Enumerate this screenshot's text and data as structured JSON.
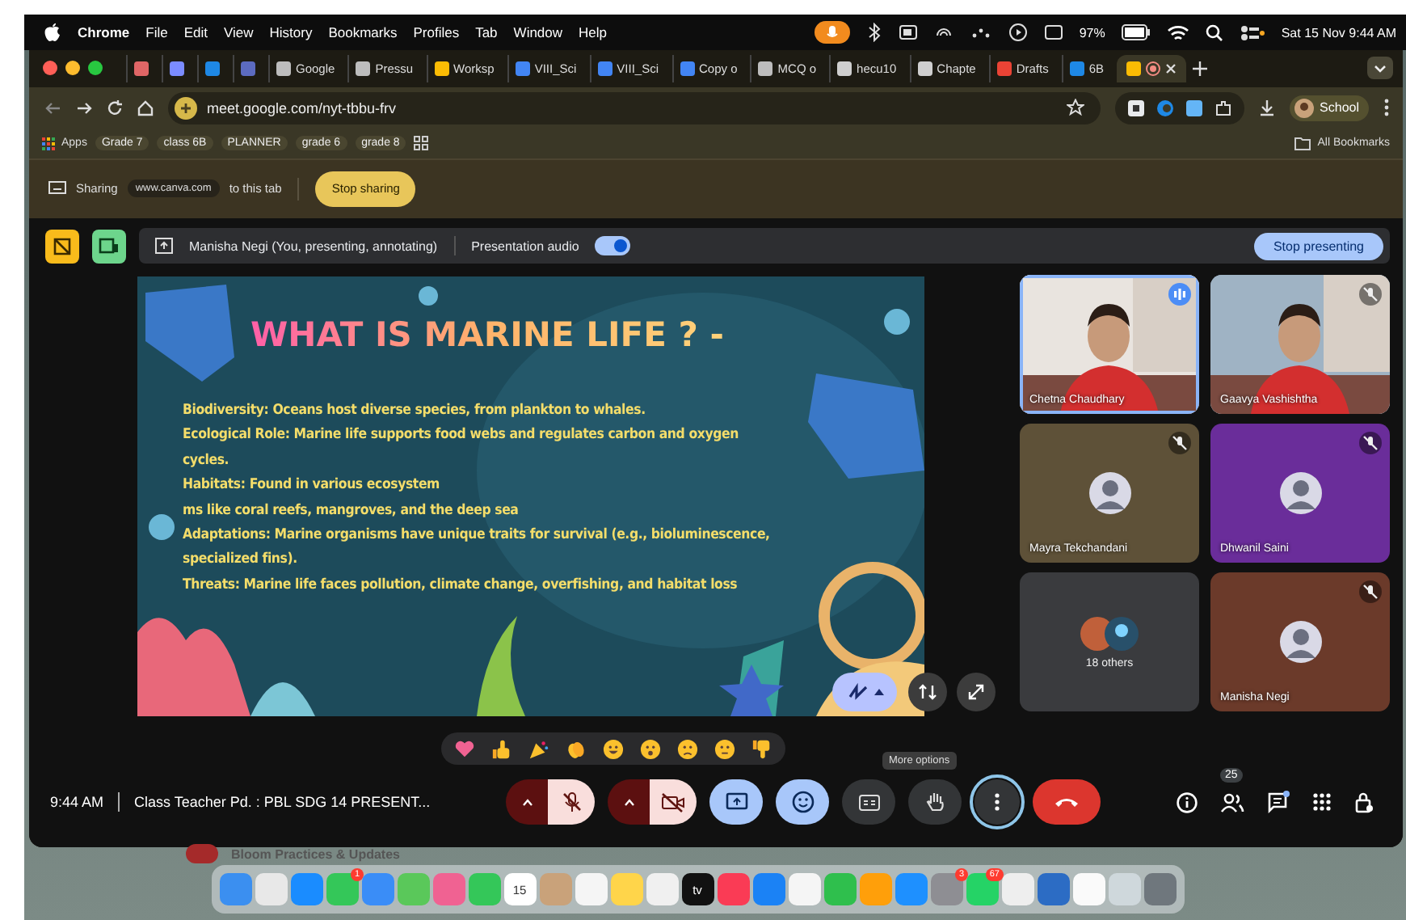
{
  "menu_bar": {
    "app": "Chrome",
    "items": [
      "File",
      "Edit",
      "View",
      "History",
      "Bookmarks",
      "Profiles",
      "Tab",
      "Window",
      "Help"
    ],
    "battery": "97%",
    "clock": "Sat 15 Nov 9:44 AM"
  },
  "tabs": [
    {
      "color": "#e06666",
      "selected": false
    },
    {
      "color": "#7b8cff",
      "selected": false
    },
    {
      "color": "#1e88e5",
      "selected": false
    },
    {
      "color": "#5c6bc0",
      "selected": false
    },
    {
      "title": "Google",
      "color": "#bdbdbd",
      "selected": false
    },
    {
      "title": "Pressu",
      "color": "#bdbdbd",
      "selected": false
    },
    {
      "title": "Worksp",
      "color": "#fbbc04",
      "selected": false
    },
    {
      "title": "VIII_Sci",
      "color": "#4285f4",
      "selected": false
    },
    {
      "title": "VIII_Sci",
      "color": "#4285f4",
      "selected": false
    },
    {
      "title": "Copy o",
      "color": "#4285f4",
      "selected": false
    },
    {
      "title": "MCQ o",
      "color": "#bdbdbd",
      "selected": false
    },
    {
      "title": "hecu10",
      "color": "#cfcfcf",
      "selected": false
    },
    {
      "title": "Chapte",
      "color": "#cfcfcf",
      "selected": false
    },
    {
      "title": "Drafts",
      "color": "#ea4335",
      "selected": false
    },
    {
      "title": "6B",
      "color": "#1e88e5",
      "selected": false
    },
    {
      "color": "#fbbc04",
      "selected": true
    }
  ],
  "address_bar": {
    "url": "meet.google.com/nyt-tbbu-frv",
    "profile": "School"
  },
  "bookmarks": {
    "items": [
      "Apps",
      "Grade 7",
      "class 6B",
      "PLANNER",
      "grade 6",
      "grade 8"
    ],
    "all": "All Bookmarks"
  },
  "sharing_bar": {
    "label": "Sharing",
    "site": "www.canva.com",
    "suffix": "to this tab",
    "button": "Stop sharing"
  },
  "presenter_bar": {
    "presenter": "Manisha Negi (You, presenting, annotating)",
    "audio_label": "Presentation audio",
    "audio_on": true,
    "button": "Stop presenting"
  },
  "slide": {
    "title": "WHAT IS MARINE LIFE ? -",
    "lines": [
      "Biodiversity: Oceans host diverse species, from plankton to whales.",
      "Ecological Role: Marine life supports food webs and regulates carbon and oxygen cycles.",
      "Habitats: Found in various ecosystem",
      "ms like coral reefs, mangroves, and the deep sea",
      "Adaptations: Marine organisms have unique traits for survival (e.g., bioluminescence, specialized fins).",
      "Threats: Marine life faces pollution, climate change, overfishing, and habitat loss"
    ]
  },
  "participants": [
    {
      "name": "Chetna Chaudhary",
      "kind": "video",
      "muted": false,
      "speaking": true,
      "color": "#e9e4df"
    },
    {
      "name": "Gaavya Vashishtha",
      "kind": "video",
      "muted": true,
      "speaking": false,
      "color": "#9fb3c4"
    },
    {
      "name": "Mayra Tekchandani",
      "kind": "avatar",
      "muted": true,
      "speaking": false,
      "color": "#5e5138"
    },
    {
      "name": "Dhwanil Saini",
      "kind": "avatar",
      "muted": true,
      "speaking": false,
      "color": "#6a2d9a"
    },
    {
      "name": "18 others",
      "kind": "others",
      "muted": false,
      "speaking": false,
      "color": "#3a3b3e"
    },
    {
      "name": "Manisha Negi",
      "kind": "avatar",
      "muted": true,
      "speaking": false,
      "color": "#6b3a2a"
    }
  ],
  "reactions": [
    {
      "kind": "heart"
    },
    {
      "kind": "thumbs-up"
    },
    {
      "kind": "party"
    },
    {
      "kind": "clap"
    },
    {
      "kind": "laugh"
    },
    {
      "kind": "surprised"
    },
    {
      "kind": "sad"
    },
    {
      "kind": "thinking"
    },
    {
      "kind": "thumbs-down"
    }
  ],
  "tooltip": "More options",
  "call_bar": {
    "time": "9:44 AM",
    "title": "Class Teacher Pd. : PBL SDG 14 PRESENT...",
    "mic_on": false,
    "camera_on": false,
    "people_count": "25"
  },
  "background_window": {
    "title": "Bloom Practices & Updates"
  },
  "dock": [
    {
      "color": "#3b8ff0"
    },
    {
      "color": "#e8e8e8"
    },
    {
      "color": "#1a8cff"
    },
    {
      "color": "#34c759",
      "badge": "1"
    },
    {
      "color": "#3a8df7"
    },
    {
      "color": "#5ac85a"
    },
    {
      "color": "#f06292"
    },
    {
      "color": "#34c759"
    },
    {
      "color": "#ffffff",
      "label": "15"
    },
    {
      "color": "#c9a27a"
    },
    {
      "color": "#f5f5f5"
    },
    {
      "color": "#ffd54a"
    },
    {
      "color": "#f0f0f0"
    },
    {
      "color": "#111111",
      "label": "tv"
    },
    {
      "color": "#fa3b55"
    },
    {
      "color": "#1b82f5"
    },
    {
      "color": "#f5f5f5"
    },
    {
      "color": "#2fbf4d"
    },
    {
      "color": "#ff9f0a"
    },
    {
      "color": "#1e90ff"
    },
    {
      "color": "#8e8e93",
      "badge": "3"
    },
    {
      "color": "#25d366",
      "badge": "67"
    },
    {
      "color": "#eeeeee"
    },
    {
      "color": "#2c6cc4"
    },
    {
      "color": "#fafafa"
    },
    {
      "color": "#cfd8dc"
    },
    {
      "color": "#6f777d"
    }
  ]
}
